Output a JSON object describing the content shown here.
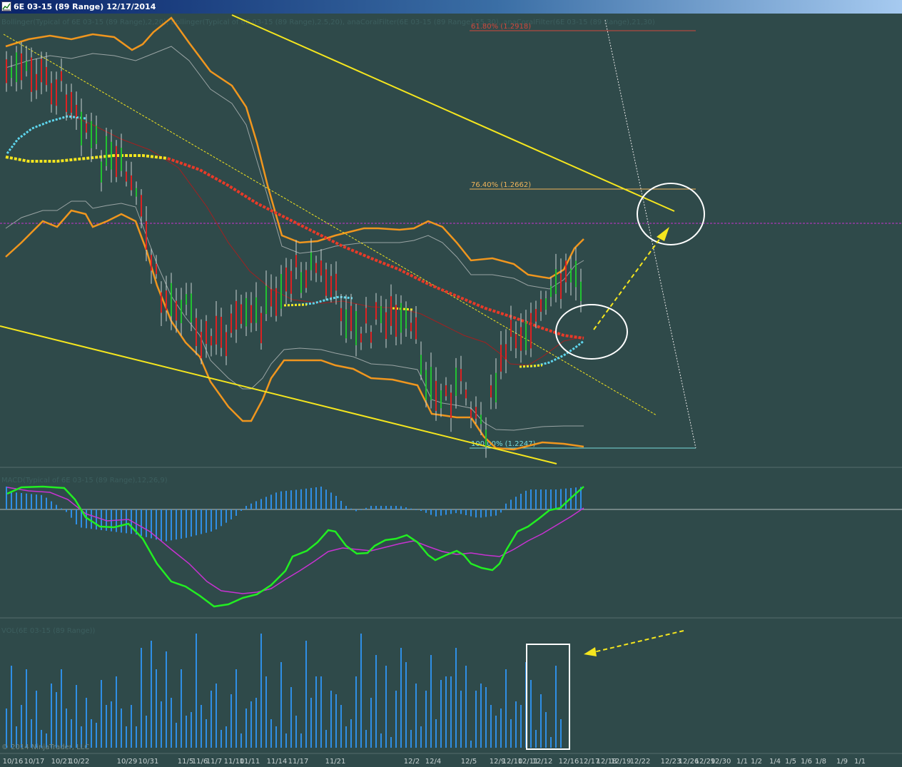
{
  "window": {
    "title": "6E 03-15 (89 Range)  12/17/2014"
  },
  "colors": {
    "background": "#2f4a4a",
    "bollinger_outer": "#f0961e",
    "bollinger_inner": "#9aa4a4",
    "trendline": "#f5e61e",
    "coral_up": "#5ed6ee",
    "coral_down": "#e83a28",
    "coral_flat": "#f5e61e",
    "macd_line": "#22ee22",
    "signal_line": "#c832d2",
    "histogram": "#2f8fe6",
    "volume": "#2f8fe6",
    "up_bar": "#22c232",
    "down_bar": "#dd2222",
    "fib_red": "#d2483c",
    "fib_orange": "#f0b45a",
    "fib_cyan": "#78dcdc",
    "magenta_line": "#c832d2"
  },
  "chart_data": [
    {
      "type": "candlestick",
      "panel": "price",
      "indicator_label": "Bollinger(Typical of 6E 03-15 (89 Range),2,20), Bollinger(Typical of 6E 03-15 (89 Range),2.5,20), anaCoralFilter(6E 03-15 (89 Range),55,30), anaCoralFilter(6E 03-15 (89 Range),21,30)",
      "fibonacci_levels": [
        {
          "label": "61.80% (1.2918)",
          "value": 1.2918
        },
        {
          "label": "76.40% (1.2662)",
          "value": 1.2662
        },
        {
          "label": "100.00% (1.2247)",
          "value": 1.2247
        }
      ],
      "annotations": [
        "yellow descending trendline channel",
        "white circles",
        "yellow dashed arrow"
      ]
    },
    {
      "type": "line",
      "panel": "macd",
      "indicator_label": "MACD(Typical of 6E 03-15 (89 Range),12,26,9)",
      "series": [
        "MACD",
        "Signal",
        "Histogram"
      ]
    },
    {
      "type": "bar",
      "panel": "volume",
      "indicator_label": "VOL(6E 03-15 (89 Range))",
      "annotations": [
        "white rectangle around last bars",
        "yellow dashed arrow"
      ]
    }
  ],
  "x_axis": {
    "labels": [
      "10/16",
      "10/17",
      "10/21",
      "10/22",
      "10/29",
      "10/31",
      "11/5",
      "11/6",
      "11/7",
      "11/10",
      "11/11",
      "11/14",
      "11/17",
      "11/21",
      "12/2",
      "12/4",
      "12/5",
      "12/9",
      "12/10",
      "12/11",
      "12/12",
      "12/16",
      "12/17",
      "12/18",
      "12/19",
      "12/22",
      "12/23",
      "12/26",
      "12/29",
      "12/30",
      "1/1",
      "1/2",
      "1/4",
      "1/5",
      "1/6",
      "1/8",
      "1/9",
      "1/1"
    ]
  },
  "copyright": "© 2014 NinjaTrader, LLC"
}
